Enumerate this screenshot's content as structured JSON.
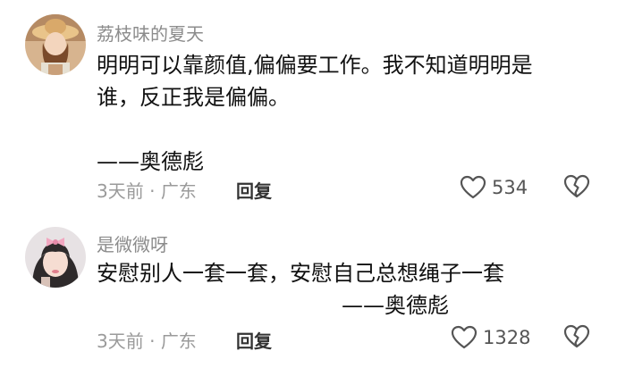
{
  "comments": [
    {
      "username": "荔枝味的夏天",
      "content_lines": [
        "明明可以靠颜值,偏偏要工作。我不知道明明是",
        "谁，反正我是偏偏。"
      ],
      "signature": "——奥德彪",
      "time": "3天前",
      "separator": "·",
      "location": "广东",
      "reply_label": "回复",
      "likes": "534",
      "avatar_icon": "girl-with-hat-avatar"
    },
    {
      "username": "是微微呀",
      "content_lines": [
        "安慰别人一套一套，安慰自己总想绳子一套"
      ],
      "signature": "——奥德彪",
      "time": "3天前",
      "separator": "·",
      "location": "广东",
      "reply_label": "回复",
      "likes": "1328",
      "avatar_icon": "girl-with-bow-avatar"
    }
  ],
  "colors": {
    "username": "#8c8c8c",
    "text": "#111111",
    "meta": "#9a9a9a",
    "icon_stroke": "#555555"
  }
}
